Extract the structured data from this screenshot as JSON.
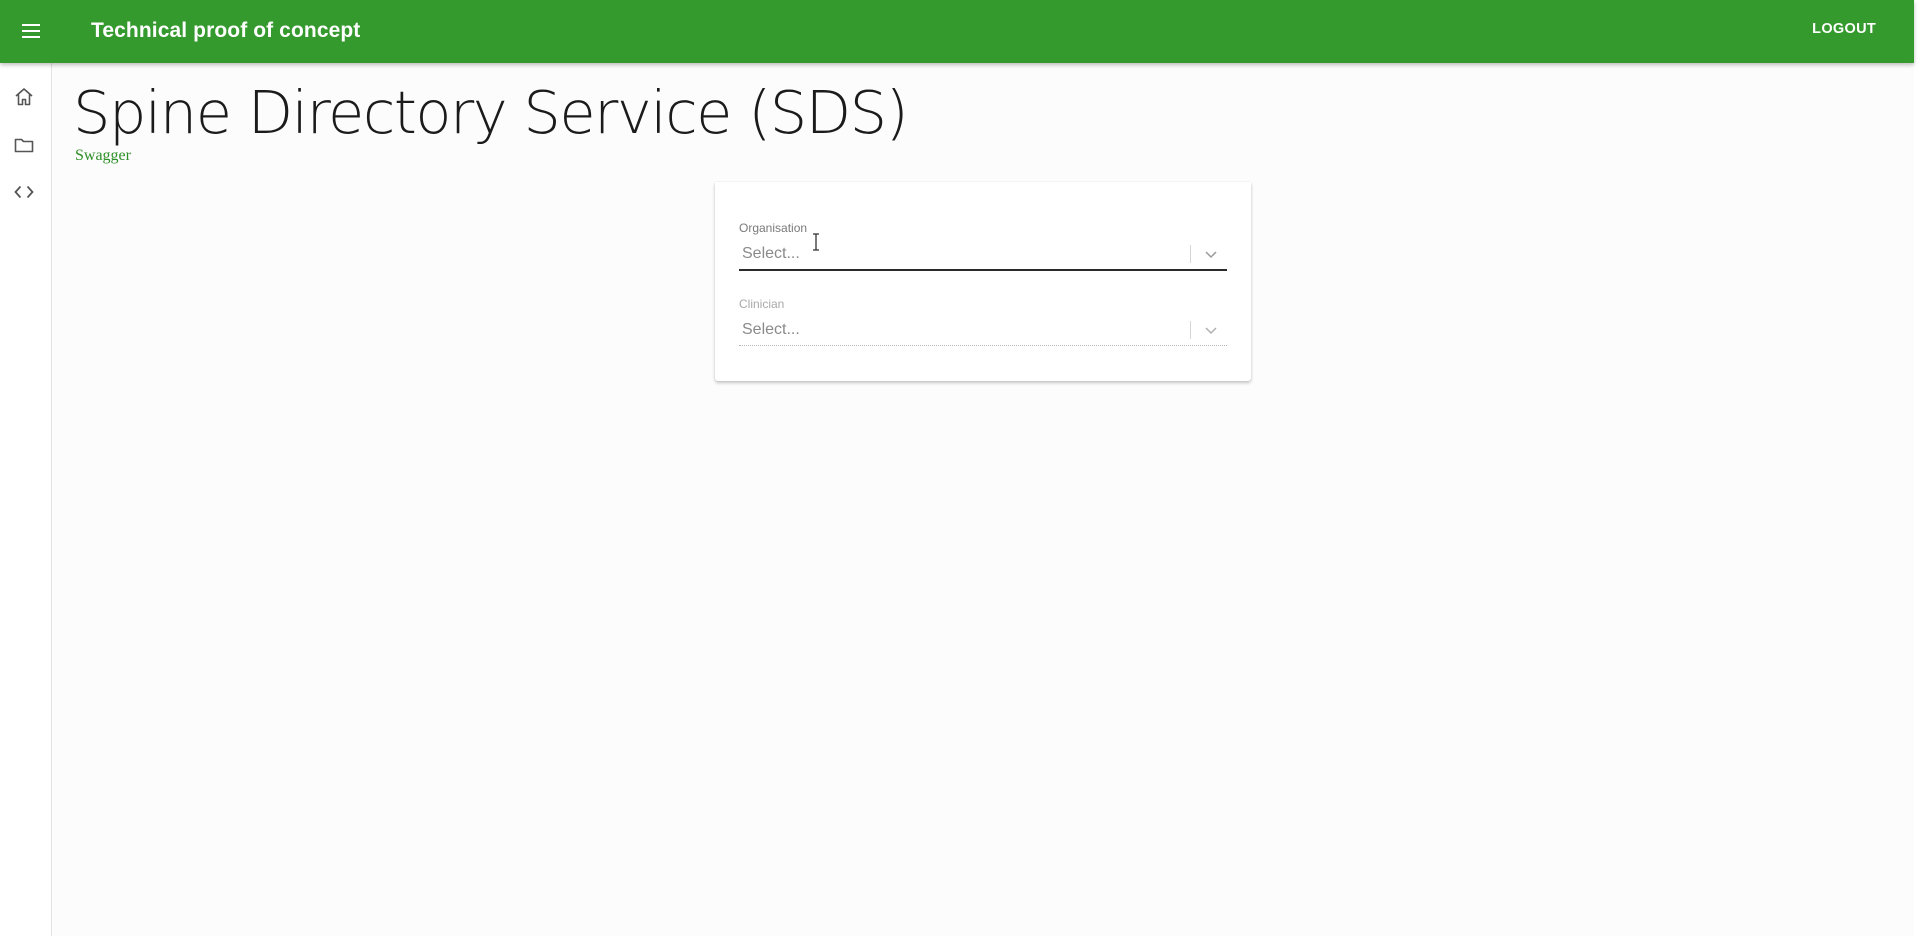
{
  "appbar": {
    "title": "Technical proof of concept",
    "logout_label": "LOGOUT",
    "background_color": "#359a2e",
    "menu_icon": "menu-icon"
  },
  "side_rail": {
    "items": [
      {
        "icon": "home-icon"
      },
      {
        "icon": "folder-icon"
      },
      {
        "icon": "code-icon"
      }
    ]
  },
  "page": {
    "title": "Spine Directory Service (SDS)",
    "swagger_link": "Swagger"
  },
  "form": {
    "organisation": {
      "label": "Organisation",
      "placeholder": "Select..."
    },
    "clinician": {
      "label": "Clinician",
      "placeholder": "Select..."
    }
  }
}
